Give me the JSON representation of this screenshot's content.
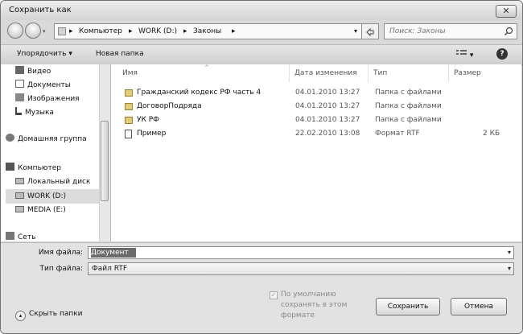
{
  "window": {
    "title": "Сохранить как",
    "close_glyph": "✕"
  },
  "address": {
    "crumbs": [
      "Компьютер",
      "WORK (D:)",
      "Законы"
    ],
    "separator": "▸",
    "search_placeholder": "Поиск: Законы"
  },
  "toolbar": {
    "organize_label": "Упорядочить",
    "organize_caret": "▾",
    "new_folder_label": "Новая папка",
    "view_caret": "▾",
    "help_glyph": "?"
  },
  "sidebar": {
    "items": [
      {
        "label": "Видео",
        "icon": "video-icon"
      },
      {
        "label": "Документы",
        "icon": "documents-icon"
      },
      {
        "label": "Изображения",
        "icon": "images-icon"
      },
      {
        "label": "Музыка",
        "icon": "music-icon"
      },
      {
        "label": "Домашняя группа",
        "icon": "homegroup-icon"
      },
      {
        "label": "Компьютер",
        "icon": "computer-icon"
      },
      {
        "label": "Локальный диск",
        "icon": "drive-icon"
      },
      {
        "label": "WORK (D:)",
        "icon": "drive-icon",
        "selected": true
      },
      {
        "label": "MEDIA (E:)",
        "icon": "drive-icon"
      },
      {
        "label": "Сеть",
        "icon": "network-icon"
      }
    ]
  },
  "file_list": {
    "columns": [
      "Имя",
      "Дата изменения",
      "Тип",
      "Размер"
    ],
    "rows": [
      {
        "name": "Гражданский кодекс РФ часть 4",
        "date": "04.01.2010 13:27",
        "type": "Папка с файлами",
        "size": "",
        "icon": "folder-icon"
      },
      {
        "name": "ДоговорПодряда",
        "date": "04.01.2010 13:27",
        "type": "Папка с файлами",
        "size": "",
        "icon": "folder-icon"
      },
      {
        "name": "УК РФ",
        "date": "04.01.2010 13:27",
        "type": "Папка с файлами",
        "size": "",
        "icon": "folder-icon"
      },
      {
        "name": "Пример",
        "date": "22.02.2010 13:08",
        "type": "Формат RTF",
        "size": "2 КБ",
        "icon": "rtf-file-icon"
      }
    ]
  },
  "form": {
    "filename_label": "Имя файла:",
    "filename_value": "Документ",
    "filetype_label": "Тип файла:",
    "filetype_value": "Файл RTF",
    "default_save_label": "По умолчанию сохранять в этом формате",
    "default_save_checked": true,
    "check_glyph": "✓",
    "save_button": "Сохранить",
    "cancel_button": "Отмена",
    "hide_folders_label": "Скрыть папки",
    "hide_glyph": "▴",
    "dropdown_glyph": "▾"
  }
}
